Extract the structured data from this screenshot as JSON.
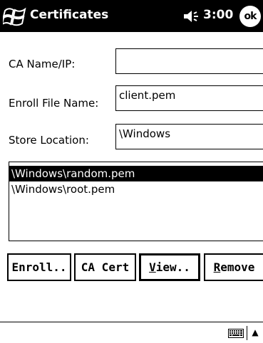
{
  "title_bar": {
    "app_title": "Certificates",
    "clock": "3:00",
    "ok_label": "ok",
    "icons": {
      "start": "windows-flag-icon",
      "volume": "speaker-icon"
    }
  },
  "form": {
    "ca_name": {
      "label": "CA Name/IP:",
      "value": ""
    },
    "enroll_file": {
      "label": "Enroll File Name:",
      "value": "client.pem"
    },
    "store_location": {
      "label": "Store Location:",
      "value": "\\Windows"
    }
  },
  "cert_list": {
    "items": [
      "\\Windows\\random.pem",
      "\\Windows\\root.pem"
    ],
    "selected_index": 0
  },
  "buttons": {
    "enroll": "Enroll..",
    "ca_cert": "CA Cert",
    "view_key": "V",
    "view_rest": "iew..",
    "remove_key": "R",
    "remove_rest": "emove"
  },
  "menu_bar": {
    "icons": {
      "keyboard": "keyboard-icon",
      "sip_arrow": "up-arrow-icon"
    },
    "arrow_glyph": "▲"
  },
  "colors": {
    "title_bar_bg": "#000000",
    "selection_bg": "#000000",
    "background": "#ffffff"
  }
}
